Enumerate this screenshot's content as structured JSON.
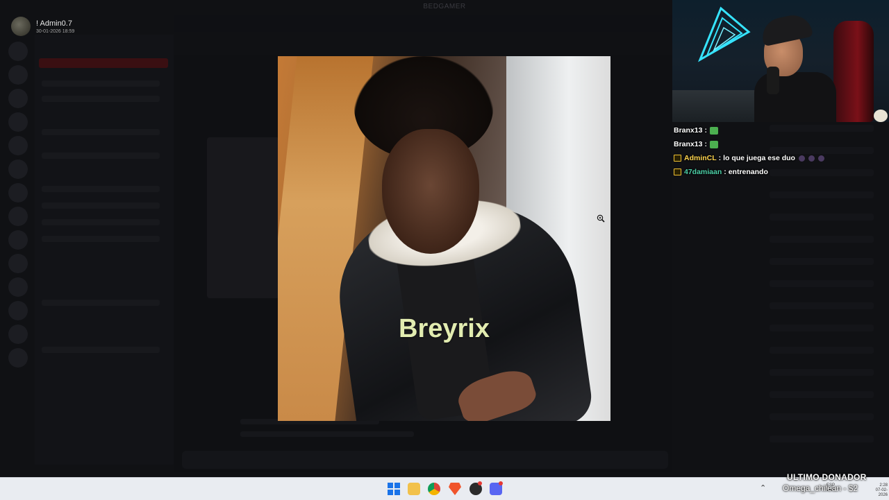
{
  "discord": {
    "window_title": "BEDGAMER",
    "server_name": "BEDGAMER",
    "poster": {
      "name": "! Admin0.7",
      "date": "30-01-2026 18:59"
    }
  },
  "viewer": {
    "caption": "Breyrix",
    "zoom_icon": "zoom-in-icon"
  },
  "stream_chat": [
    {
      "user": "Branx13",
      "text": "",
      "user_color": "#ffffff",
      "badge": false,
      "emotes": 1,
      "emote_type": "green"
    },
    {
      "user": "Branx13",
      "text": "",
      "user_color": "#ffffff",
      "badge": false,
      "emotes": 1,
      "emote_type": "green"
    },
    {
      "user": "AdminCL",
      "text": "lo que juega ese duo",
      "user_color": "#ffd54f",
      "badge": true,
      "emotes": 3,
      "emote_type": "purple"
    },
    {
      "user": "47damiaan",
      "text": "entrenando",
      "user_color": "#4dd0a8",
      "badge": true,
      "emotes": 0,
      "emote_type": ""
    }
  ],
  "overlay": {
    "donor_title": "ULTIMO DONADOR",
    "donor_name": "Omega_chilean - $2"
  },
  "taskbar": {
    "icons": [
      "windows-start-icon",
      "file-explorer-icon",
      "chrome-icon",
      "brave-icon",
      "obs-icon",
      "discord-icon"
    ],
    "lang": "ESP",
    "lang_sub": "LAA",
    "time": "2:28",
    "date": "07-02-2026"
  },
  "colors": {
    "accent_discord": "#5865f2",
    "caption": "#e2ecb0"
  }
}
